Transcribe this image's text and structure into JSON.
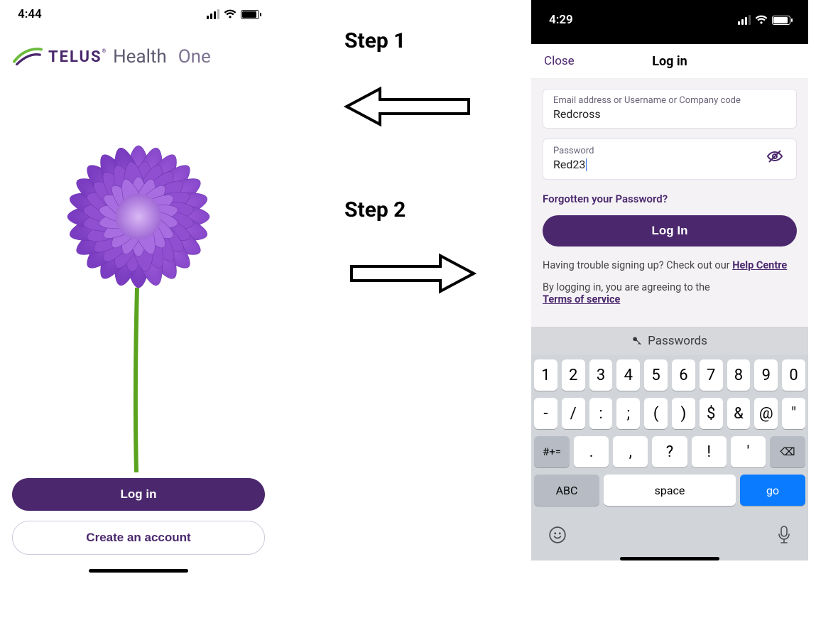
{
  "annotations": {
    "step1": "Step 1",
    "step2": "Step 2"
  },
  "left": {
    "status": {
      "time": "4:44"
    },
    "brand": {
      "telus": "TELUS",
      "mark": "®",
      "health": "Health",
      "one": "One"
    },
    "buttons": {
      "login": "Log in",
      "create": "Create an account"
    }
  },
  "right": {
    "status": {
      "time": "4:29"
    },
    "header": {
      "close": "Close",
      "title": "Log in"
    },
    "fields": {
      "id_label": "Email address or Username or Company code",
      "id_value": "Redcross",
      "pw_label": "Password",
      "pw_value": "Red23"
    },
    "forgot": "Forgotten your Password?",
    "login_btn": "Log In",
    "help_prefix": "Having trouble signing up? Check out our ",
    "help_link": "Help Centre",
    "tos_prefix": "By logging in, you are agreeing to the",
    "tos_link": "Terms of service",
    "keyboard": {
      "suggestion": "Passwords",
      "row1": [
        "1",
        "2",
        "3",
        "4",
        "5",
        "6",
        "7",
        "8",
        "9",
        "0"
      ],
      "row2": [
        "-",
        "/",
        ":",
        ";",
        "(",
        ")",
        "$",
        "&",
        "@",
        "\""
      ],
      "row3_switch": "#+=",
      "row3": [
        ".",
        ",",
        "?",
        "!",
        "'"
      ],
      "backspace": "⌫",
      "abc": "ABC",
      "space": "space",
      "go": "go"
    }
  }
}
